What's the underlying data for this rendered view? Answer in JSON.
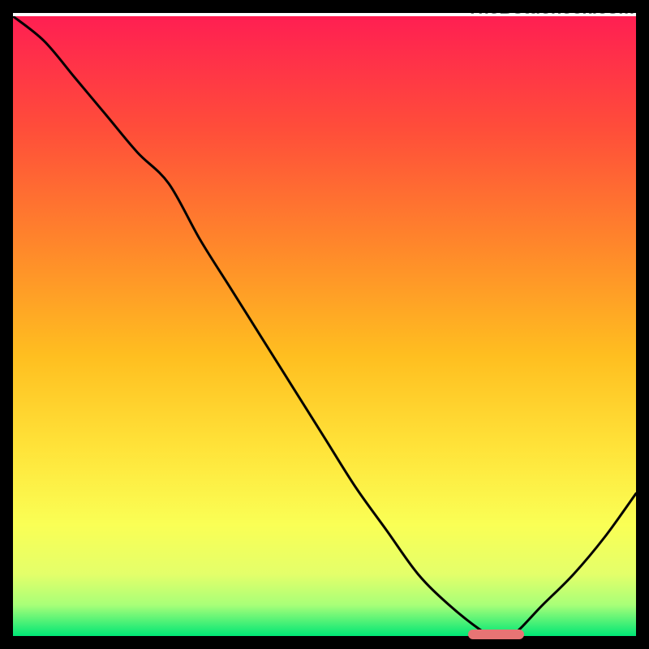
{
  "watermark": "TheBottleneck.com",
  "colors": {
    "gradient_top": "#ff1f52",
    "gradient_mid1": "#ff7a2f",
    "gradient_mid2": "#ffd32a",
    "gradient_mid3": "#f6ff5a",
    "gradient_mid4": "#c6ff70",
    "gradient_bottom": "#00e676",
    "curve": "#000000",
    "marker": "#e77474",
    "frame": "#000000"
  },
  "chart_data": {
    "type": "line",
    "title": "",
    "xlabel": "",
    "ylabel": "",
    "xlim": [
      0,
      100
    ],
    "ylim": [
      0,
      100
    ],
    "grid": false,
    "legend": false,
    "series": [
      {
        "name": "curve",
        "x": [
          0,
          5,
          10,
          15,
          20,
          25,
          30,
          35,
          40,
          45,
          50,
          55,
          60,
          65,
          70,
          75,
          77,
          80,
          85,
          90,
          95,
          100
        ],
        "values": [
          100,
          96,
          90,
          84,
          78,
          73,
          64,
          56,
          48,
          40,
          32,
          24,
          17,
          10,
          5,
          1,
          0,
          0,
          5,
          10,
          16,
          23
        ]
      }
    ],
    "annotations": [
      {
        "name": "optimal-marker",
        "x_start": 73,
        "x_end": 82,
        "y": 0
      }
    ]
  }
}
